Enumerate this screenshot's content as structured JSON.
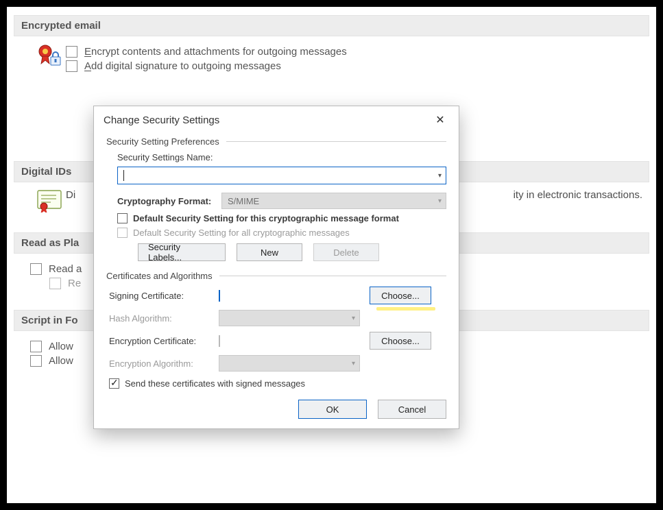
{
  "page": {
    "section_encrypted": "Encrypted email",
    "encrypt_label_pre": "E",
    "encrypt_label_rest": "ncrypt contents and attachments for outgoing messages",
    "add_sig_pre": "A",
    "add_sig_rest": "dd digital signature to outgoing messages",
    "section_digital": "Digital IDs",
    "digital_row_start": "Di",
    "digital_row_end": "ity in electronic transactions.",
    "section_read": "Read as Pla",
    "read_all": "Read a",
    "read_sub": "Re",
    "section_script": "Script in Fo",
    "allow1": "Allow",
    "allow2": "Allow"
  },
  "dlg": {
    "title": "Change Security Settings",
    "group_prefs": "Security Setting Preferences",
    "settings_name_lbl": "Security Settings Name:",
    "crypto_fmt_lbl": "Cryptography Format:",
    "crypto_fmt_val": "S/MIME",
    "chk_default_fmt": "Default Security Setting for this cryptographic message format",
    "chk_default_all": "Default Security Setting for all cryptographic messages",
    "btn_security_labels": "Security Labels...",
    "btn_new": "New",
    "btn_delete": "Delete",
    "group_certs": "Certificates and Algorithms",
    "signing_cert_lbl": "Signing Certificate:",
    "hash_algo_lbl": "Hash Algorithm:",
    "enc_cert_lbl": "Encryption Certificate:",
    "enc_algo_lbl": "Encryption Algorithm:",
    "btn_choose": "Choose...",
    "chk_send_certs": "Send these certificates with signed messages",
    "btn_ok": "OK",
    "btn_cancel": "Cancel"
  }
}
